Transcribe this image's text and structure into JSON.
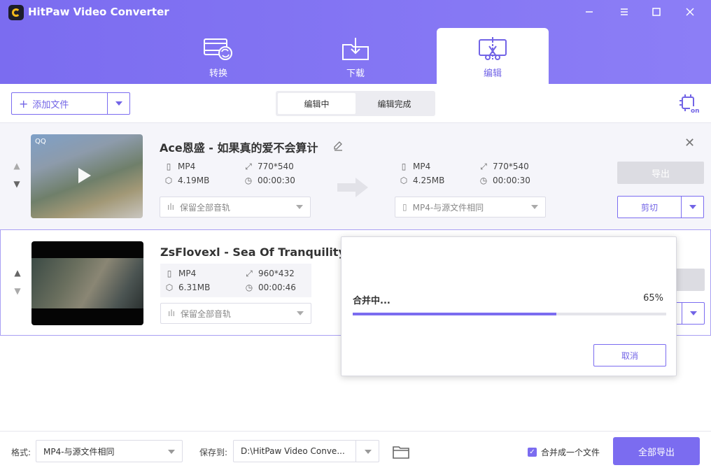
{
  "app": {
    "title": "HitPaw Video Converter"
  },
  "nav": {
    "tabs": [
      {
        "label": "转换",
        "icon": "film-convert-icon"
      },
      {
        "label": "下载",
        "icon": "folder-download-icon"
      },
      {
        "label": "编辑",
        "icon": "screen-scissors-icon",
        "active": true
      }
    ]
  },
  "toolbar": {
    "add_file": "添加文件",
    "segments": [
      "编辑中",
      "编辑完成"
    ],
    "active_segment": "编辑中"
  },
  "items": [
    {
      "title": "Ace恩盛 - 如果真的爱不会算计",
      "thumb_tag": "QQ",
      "source": {
        "format": "MP4",
        "resolution": "770*540",
        "size": "4.19MB",
        "duration": "00:00:30"
      },
      "audio_track": "保留全部音轨",
      "output": {
        "format": "MP4",
        "resolution": "770*540",
        "size": "4.25MB",
        "duration": "00:00:30"
      },
      "output_format": "MP4-与源文件相同",
      "export_label": "导出",
      "cut_label": "剪切"
    },
    {
      "title": "ZsFlovexl - Sea Of Tranquility",
      "source": {
        "format": "MP4",
        "resolution": "960*432",
        "size": "6.31MB",
        "duration": "00:00:46"
      },
      "audio_track": "保留全部音轨"
    }
  ],
  "modal": {
    "title": "合并中...",
    "progress_pct": 65,
    "progress_text": "65%",
    "cancel": "取消"
  },
  "footer": {
    "format_label": "格式:",
    "format_value": "MP4-与源文件相同",
    "save_label": "保存到:",
    "save_path": "D:\\HitPaw Video Conve...",
    "merge_label": "合并成一个文件",
    "merge_checked": true,
    "export_all": "全部导出"
  },
  "colors": {
    "accent": "#7b6cf0",
    "header": "#8577f2"
  }
}
